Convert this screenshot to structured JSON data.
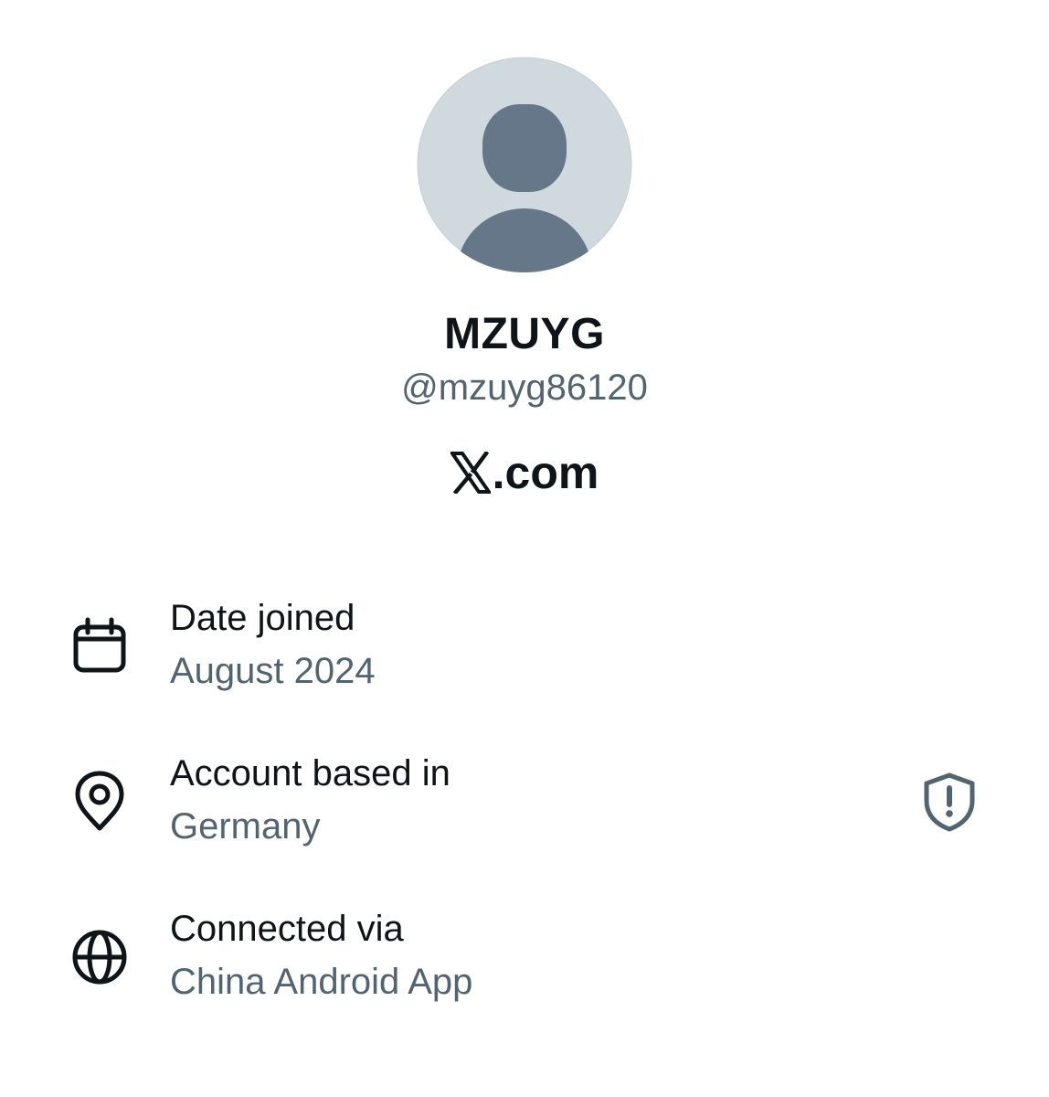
{
  "profile": {
    "display_name": "MZUYG",
    "handle": "@mzuyg86120",
    "avatar_icon": "default-avatar-icon",
    "avatar_bg": "#cfd9de",
    "avatar_fg": "#66778a"
  },
  "brand": {
    "icon": "x-logo-icon",
    "text": ".com"
  },
  "details": [
    {
      "icon": "calendar-icon",
      "title": "Date joined",
      "value": "August 2024"
    },
    {
      "icon": "location-pin-icon",
      "title": "Account based in",
      "value": "Germany",
      "action_icon": "shield-alert-icon"
    },
    {
      "icon": "globe-icon",
      "title": "Connected via",
      "value": "China Android App"
    }
  ],
  "colors": {
    "text_primary": "#0f1419",
    "text_secondary": "#536471"
  }
}
